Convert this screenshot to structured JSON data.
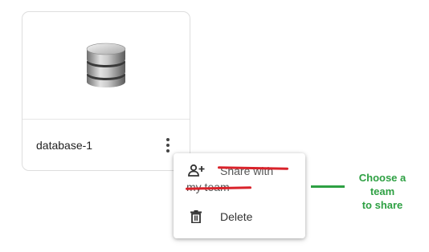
{
  "card": {
    "title": "database-1",
    "icon": "database-icon",
    "more_icon": "more-vertical-icon"
  },
  "menu": {
    "items": [
      {
        "label_line1": "Share with",
        "label_line2": "my team",
        "icon": "person-add-icon"
      },
      {
        "label": "Delete",
        "icon": "trash-icon"
      }
    ]
  },
  "annotation": {
    "line1": "Choose a team",
    "line2": "to share",
    "color": "#2ea043",
    "strike_color": "#d9222a"
  }
}
